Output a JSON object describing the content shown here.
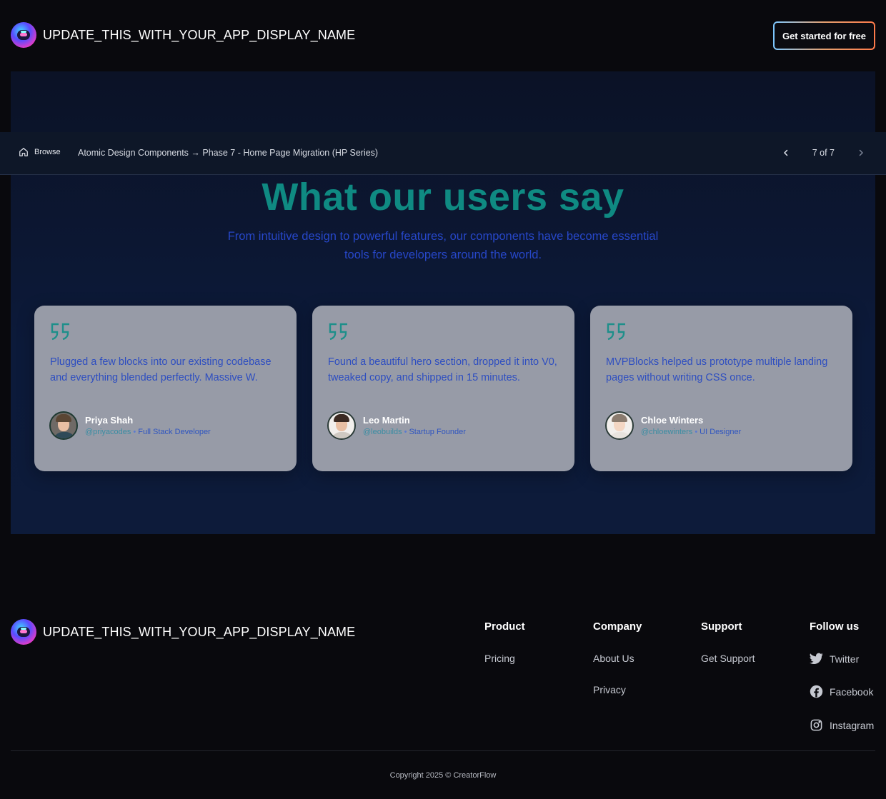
{
  "header": {
    "app_name": "UPDATE_THIS_WITH_YOUR_APP_DISPLAY_NAME",
    "cta_label": "Get started for free"
  },
  "preview_bar": {
    "browse_label": "Browse",
    "path": "Atomic Design Components → Phase 7 - Home Page Migration (HP Series)",
    "page_indicator": "7 of 7"
  },
  "testimonials": {
    "title": "What our users say",
    "subtitle": "From intuitive design to powerful features, our components have become essential tools for developers around the world.",
    "cards": [
      {
        "quote": "Plugged a few blocks into our existing codebase and everything blended perfectly. Massive W.",
        "name": "Priya Shah",
        "handle": "@priyacodes",
        "role": "Full Stack Developer"
      },
      {
        "quote": "Found a beautiful hero section, dropped it into V0, tweaked copy, and shipped in 15 minutes.",
        "name": "Leo Martin",
        "handle": "@leobuilds",
        "role": "Startup Founder"
      },
      {
        "quote": "MVPBlocks helped us prototype multiple landing pages without writing CSS once.",
        "name": "Chloe Winters",
        "handle": "@chloewinters",
        "role": "UI Designer"
      }
    ]
  },
  "footer": {
    "app_name": "UPDATE_THIS_WITH_YOUR_APP_DISPLAY_NAME",
    "columns": [
      {
        "heading": "Product",
        "links": [
          "Pricing"
        ]
      },
      {
        "heading": "Company",
        "links": [
          "About Us",
          "Privacy"
        ]
      },
      {
        "heading": "Support",
        "links": [
          "Get Support"
        ]
      },
      {
        "heading": "Follow us",
        "links": [
          "Twitter",
          "Facebook",
          "Instagram"
        ]
      }
    ],
    "copyright": "Copyright 2025 © CreatorFlow"
  },
  "icons": {
    "logo": "app-logo-icon",
    "home": "home-icon",
    "prev": "chevron-left-icon",
    "next": "chevron-right-icon",
    "quote": "quote-icon",
    "twitter": "twitter-icon",
    "facebook": "facebook-icon",
    "instagram": "instagram-icon"
  },
  "colors": {
    "accent_title": "#0f8a82",
    "subtitle": "#2747c9",
    "card_bg": "#979ba7",
    "page_bg": "#09090d"
  }
}
